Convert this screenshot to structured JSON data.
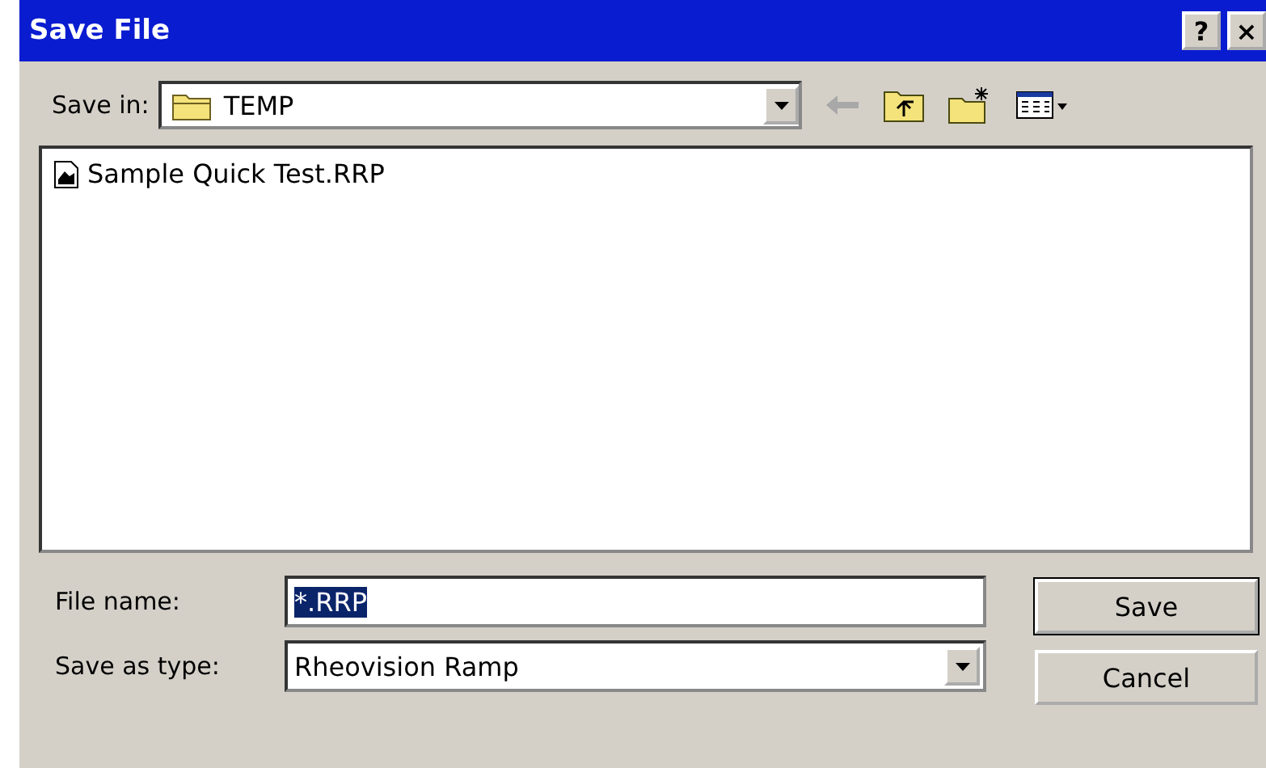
{
  "window": {
    "title": "Save File",
    "buttons": [
      "?",
      "×"
    ]
  },
  "save_in": {
    "label": "Save in:",
    "value": "TEMP"
  },
  "files": [
    {
      "name": "Sample Quick Test.RRP",
      "selected": false
    }
  ],
  "file_name": {
    "label": "File name:",
    "value": "*.RRP",
    "text_selected": true
  },
  "save_as_type": {
    "label": "Save as type:",
    "value": "Rheovision Ramp"
  },
  "buttons": [
    {
      "label": "Save",
      "default": true
    },
    {
      "label": "Cancel",
      "default": false
    }
  ]
}
